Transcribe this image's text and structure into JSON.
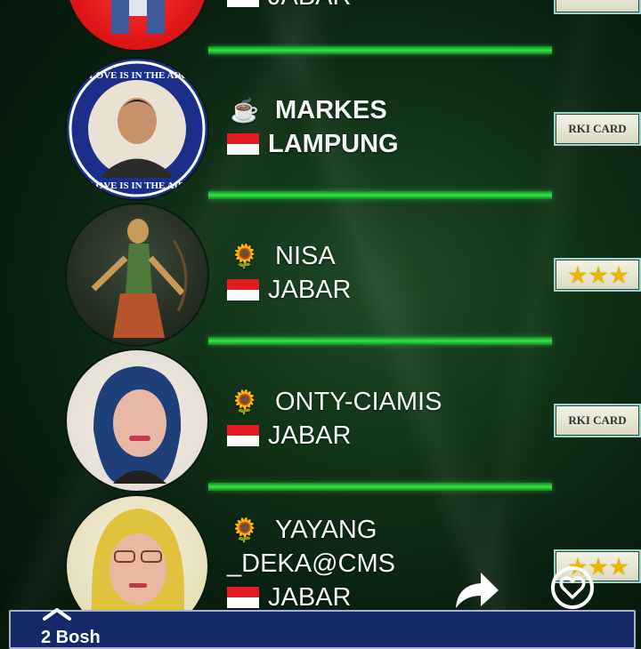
{
  "entries": [
    {
      "name": "",
      "region": "JABAR",
      "icon": "",
      "badge": "",
      "name_bold": false
    },
    {
      "name": "MARKES",
      "region": "LAMPUNG",
      "icon": "☕",
      "badge": "RKI CARD",
      "name_bold": true
    },
    {
      "name": "NISA",
      "region": "JABAR",
      "icon": "🌻",
      "badge": "★★★",
      "name_bold": false
    },
    {
      "name": "ONTY-CIAMIS",
      "region": "JABAR",
      "icon": "🌻",
      "badge": "RKI CARD",
      "name_bold": false
    },
    {
      "name": "YAYANG",
      "name_line2": "_DEKA@CMS",
      "region": "JABAR",
      "icon": "🌻",
      "badge": "★★★",
      "name_bold": false
    }
  ],
  "avatar_texts": {
    "ring": "LOVE IS IN THE AIR"
  },
  "icons": {
    "flag": "indonesia-flag-icon",
    "coffee": "coffee-icon",
    "sunflower": "sunflower-icon",
    "share": "share-icon",
    "like": "heart-icon",
    "chevron": "chevron-up-icon"
  },
  "bottom_bar": {
    "text": "2 Bosh"
  },
  "colors": {
    "divider": "#39e24c",
    "bottom_bar": "#172868"
  }
}
